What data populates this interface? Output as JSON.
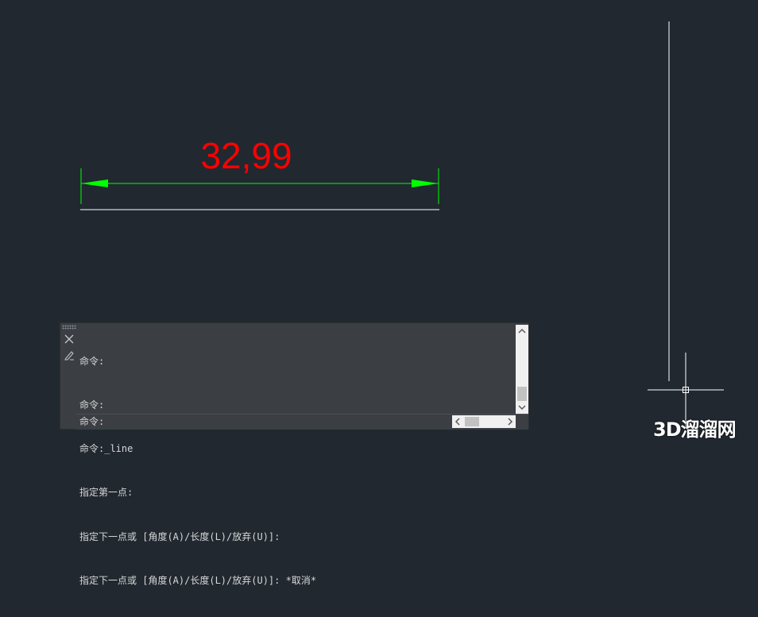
{
  "drawing": {
    "dimension_text": "32,99",
    "colors": {
      "background": "#212830",
      "dimension_line": "#00ff00",
      "dimension_text": "#ff0000",
      "geometry": "#ffffff"
    }
  },
  "command_panel": {
    "history": [
      "命令:",
      "命令:",
      "命令:_line",
      "指定第一点:",
      "指定下一点或 [角度(A)/长度(L)/放弃(U)]:",
      "指定下一点或 [角度(A)/长度(L)/放弃(U)]: *取消*"
    ],
    "prompt": "命令:",
    "input_value": "",
    "icons": [
      "grip-icon",
      "close-icon",
      "pen-icon",
      "scroll-up-icon",
      "scroll-down-icon",
      "scroll-left-icon",
      "scroll-right-icon"
    ]
  },
  "watermark": "3D溜溜网"
}
